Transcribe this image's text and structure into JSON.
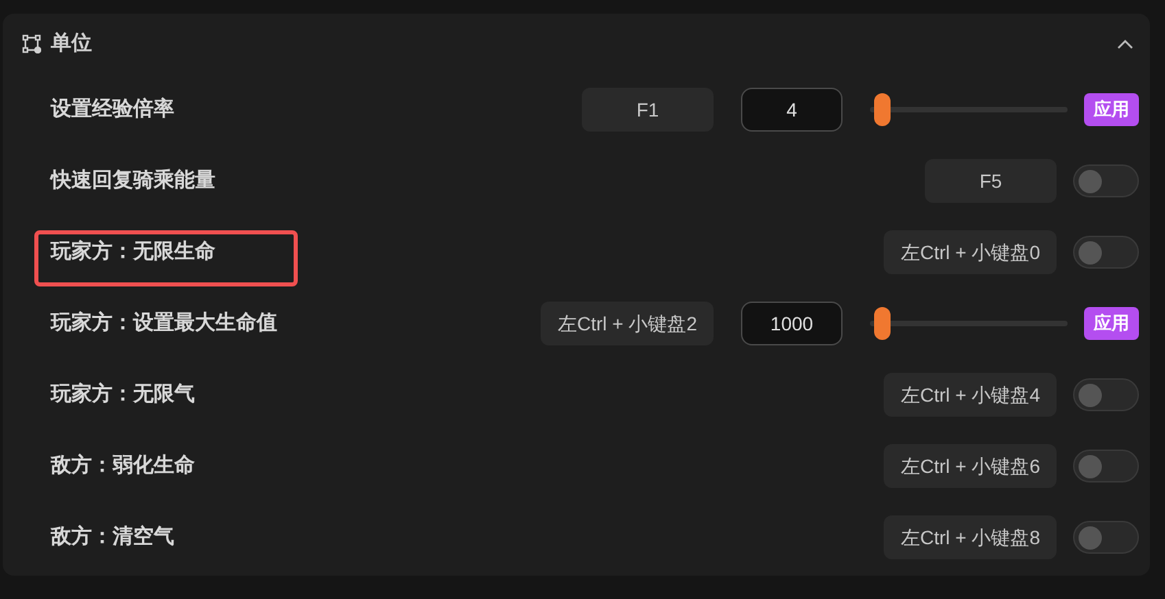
{
  "section": {
    "title": "单位",
    "expanded": true
  },
  "rows": [
    {
      "kind": "slider",
      "label": "设置经验倍率",
      "hotkey": "F1",
      "value": "4",
      "level": 0.02,
      "apply": "应用",
      "highlighted": false
    },
    {
      "kind": "toggle",
      "label": "快速回复骑乘能量",
      "hotkey": "F5",
      "on": false,
      "highlighted": false
    },
    {
      "kind": "toggle",
      "label": "玩家方：无限生命",
      "hotkey": "左Ctrl + 小键盘0",
      "on": false,
      "highlighted": true
    },
    {
      "kind": "slider",
      "label": "玩家方：设置最大生命值",
      "hotkey": "左Ctrl + 小键盘2",
      "value": "1000",
      "level": 0.02,
      "apply": "应用",
      "highlighted": false
    },
    {
      "kind": "toggle",
      "label": "玩家方：无限气",
      "hotkey": "左Ctrl + 小键盘4",
      "on": false,
      "highlighted": false
    },
    {
      "kind": "toggle",
      "label": "敌方：弱化生命",
      "hotkey": "左Ctrl + 小键盘6",
      "on": false,
      "highlighted": false
    },
    {
      "kind": "toggle",
      "label": "敌方：清空气",
      "hotkey": "左Ctrl + 小键盘8",
      "on": false,
      "highlighted": false
    }
  ]
}
